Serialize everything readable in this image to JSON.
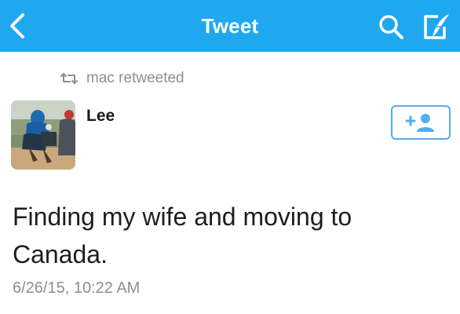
{
  "colors": {
    "accent": "#1fa8f0",
    "follow_border": "#55acee",
    "meta_text": "#8a8f94"
  },
  "navbar": {
    "back_icon": "chevron-left-icon",
    "title": "Tweet",
    "search_icon": "search-icon",
    "compose_icon": "compose-tweet-icon"
  },
  "retweet": {
    "icon": "retweet-icon",
    "text": "mac retweeted"
  },
  "tweet": {
    "author_name": "Lee",
    "follow_icon": "add-user-icon",
    "text": "Finding my wife and moving to Canada.",
    "timestamp": "6/26/15, 10:22 AM"
  }
}
